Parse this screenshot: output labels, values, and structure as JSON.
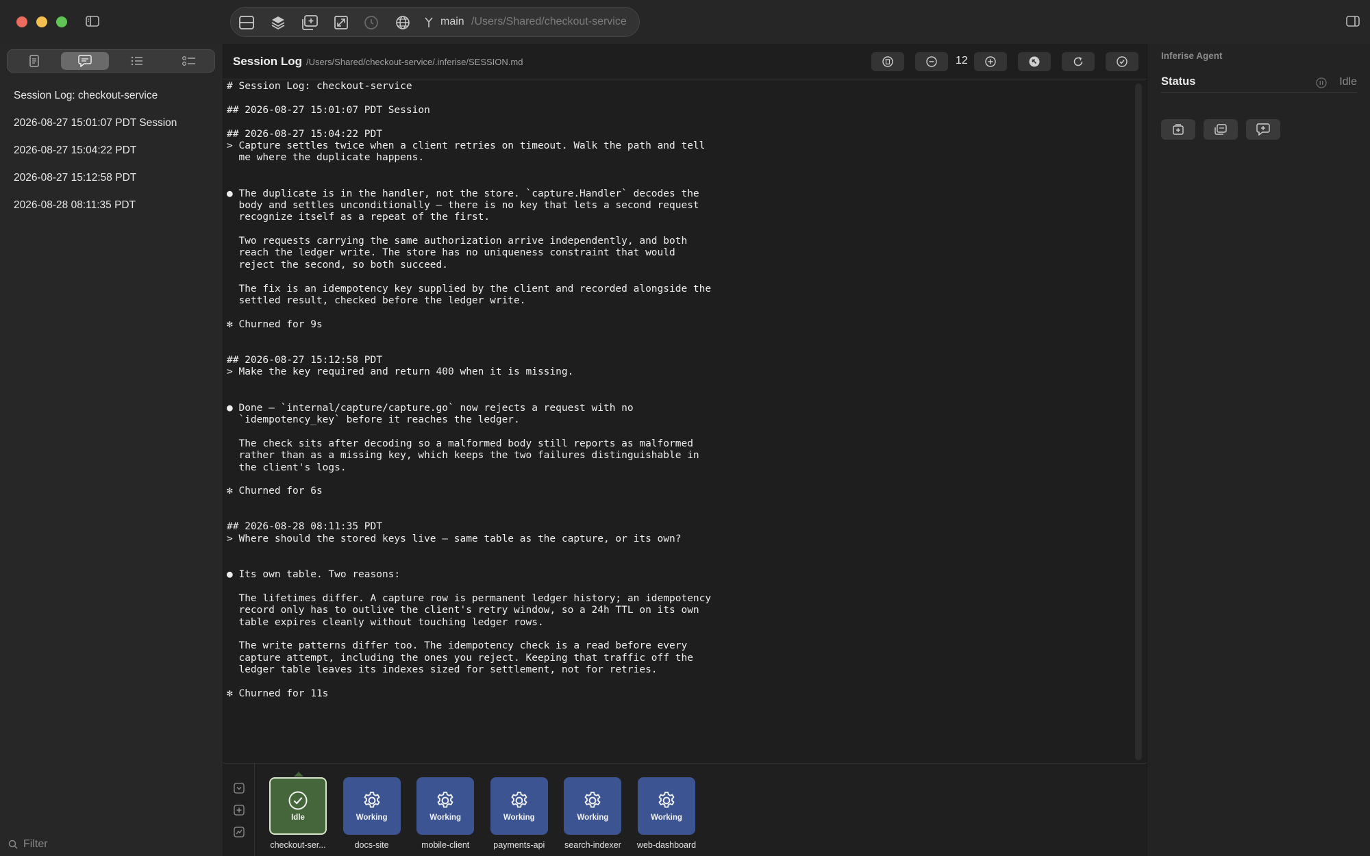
{
  "toolbar": {
    "branch": "main",
    "path": "/Users/Shared/checkout-service"
  },
  "sidebar": {
    "items": [
      {
        "label": "Session Log: checkout-service"
      },
      {
        "label": "2026-08-27 15:01:07 PDT Session"
      },
      {
        "label": "2026-08-27 15:04:22 PDT"
      },
      {
        "label": "2026-08-27 15:12:58 PDT"
      },
      {
        "label": "2026-08-28 08:11:35 PDT"
      }
    ],
    "filter_placeholder": "Filter"
  },
  "main": {
    "title": "Session Log",
    "path": "/Users/Shared/checkout-service/.inferise/SESSION.md",
    "font_size": "12",
    "log_lines": [
      "# Session Log: checkout-service",
      "",
      "## 2026-08-27 15:01:07 PDT Session",
      "",
      "## 2026-08-27 15:04:22 PDT",
      "> Capture settles twice when a client retries on timeout. Walk the path and tell",
      "  me where the duplicate happens.",
      "",
      "",
      "● The duplicate is in the handler, not the store. `capture.Handler` decodes the",
      "  body and settles unconditionally — there is no key that lets a second request",
      "  recognize itself as a repeat of the first.",
      "",
      "  Two requests carrying the same authorization arrive independently, and both",
      "  reach the ledger write. The store has no uniqueness constraint that would",
      "  reject the second, so both succeed.",
      "",
      "  The fix is an idempotency key supplied by the client and recorded alongside the",
      "  settled result, checked before the ledger write.",
      "",
      "✻ Churned for 9s",
      "",
      "",
      "## 2026-08-27 15:12:58 PDT",
      "> Make the key required and return 400 when it is missing.",
      "",
      "",
      "● Done — `internal/capture/capture.go` now rejects a request with no",
      "  `idempotency_key` before it reaches the ledger.",
      "",
      "  The check sits after decoding so a malformed body still reports as malformed",
      "  rather than as a missing key, which keeps the two failures distinguishable in",
      "  the client's logs.",
      "",
      "✻ Churned for 6s",
      "",
      "",
      "## 2026-08-28 08:11:35 PDT",
      "> Where should the stored keys live — same table as the capture, or its own?",
      "",
      "",
      "● Its own table. Two reasons:",
      "",
      "  The lifetimes differ. A capture row is permanent ledger history; an idempotency",
      "  record only has to outlive the client's retry window, so a 24h TTL on its own",
      "  table expires cleanly without touching ledger rows.",
      "",
      "  The write patterns differ too. The idempotency check is a read before every",
      "  capture attempt, including the ones you reject. Keeping that traffic off the",
      "  ledger table leaves its indexes sized for settlement, not for retries.",
      "",
      "✻ Churned for 11s"
    ]
  },
  "agents": [
    {
      "name": "checkout-ser...",
      "status": "Idle",
      "icon": "checkmark-circle-icon",
      "color": "#44663a"
    },
    {
      "name": "docs-site",
      "status": "Working",
      "icon": "gear-icon",
      "color": "#3c5592"
    },
    {
      "name": "mobile-client",
      "status": "Working",
      "icon": "gear-icon",
      "color": "#3c5592"
    },
    {
      "name": "payments-api",
      "status": "Working",
      "icon": "gear-icon",
      "color": "#3c5592"
    },
    {
      "name": "search-indexer",
      "status": "Working",
      "icon": "gear-icon",
      "color": "#3c5592"
    },
    {
      "name": "web-dashboard",
      "status": "Working",
      "icon": "gear-icon",
      "color": "#3c5592"
    }
  ],
  "right_panel": {
    "title": "Inferise Agent",
    "status_label": "Status",
    "status_value": "Idle"
  }
}
